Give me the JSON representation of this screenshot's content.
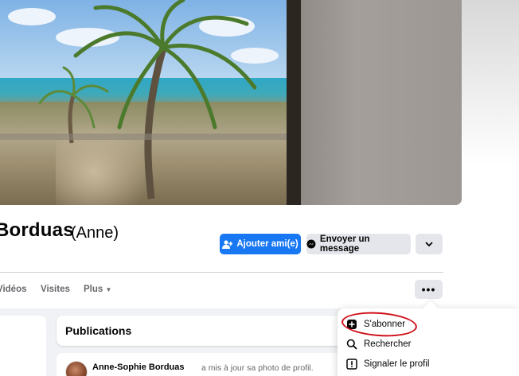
{
  "profile": {
    "name": "Borduas",
    "alternate_name": "(Anne)"
  },
  "actions": {
    "add_friend_label": "Ajouter ami(e)",
    "message_label": "Envoyer un message"
  },
  "tabs": [
    {
      "label": "Vidéos"
    },
    {
      "label": "Visites"
    },
    {
      "label": "Plus"
    }
  ],
  "feed": {
    "section_title": "Publications",
    "post_author": "Anne-Sophie Borduas",
    "post_action": "a mis à jour sa photo de profil."
  },
  "menu": {
    "items": [
      {
        "label": "S'abonner",
        "icon": "follow-icon"
      },
      {
        "label": "Rechercher",
        "icon": "search-icon"
      },
      {
        "label": "Signaler le profil",
        "icon": "report-icon"
      }
    ]
  },
  "colors": {
    "primary": "#1877f2",
    "secondary_bg": "#e4e6eb",
    "annotation": "#d0101a"
  }
}
